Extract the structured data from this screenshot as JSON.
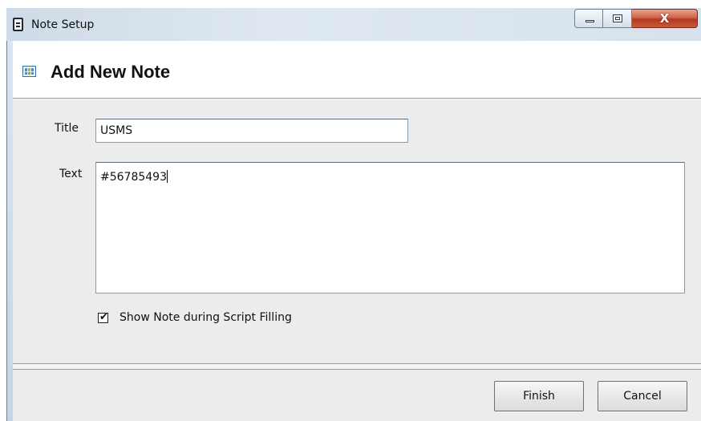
{
  "window": {
    "title": "Note Setup",
    "close_symbol": "X",
    "icons": [
      "note-icon",
      "minimize-icon",
      "maximize-icon",
      "close-icon"
    ]
  },
  "header": {
    "title": "Add New Note",
    "icon": "grid-table-icon"
  },
  "form": {
    "title_label": "Title",
    "title_value": "USMS",
    "text_label": "Text",
    "text_value": "#56785493",
    "show_note_checked": true,
    "show_note_check_glyph": "✔",
    "show_note_label": "Show Note during Script Filling"
  },
  "footer": {
    "finish_label": "Finish",
    "cancel_label": "Cancel"
  },
  "colors": {
    "close_button": "#c85a3d",
    "field_border": "#7f9db9",
    "client_background": "#ececec"
  }
}
